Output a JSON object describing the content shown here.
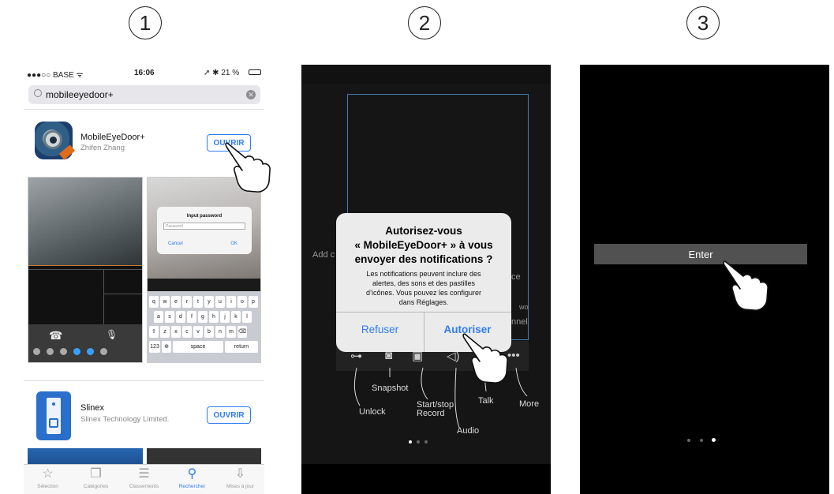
{
  "steps": [
    "1",
    "2",
    "3"
  ],
  "screen1": {
    "status": {
      "carrier": "●●●○○ BASE ᯤ",
      "time": "16:06",
      "right": "➚ ✱ 21 %"
    },
    "search": {
      "query": "mobileeyedoor+",
      "clear_icon": "clear-icon",
      "search_icon": "magnifier-icon"
    },
    "app1": {
      "name": "MobileEyeDoor+",
      "developer": "Zhifen Zhang",
      "button": "OUVRIR"
    },
    "screenshot_dialog": {
      "title": "Input password",
      "placeholder": "Password",
      "cancel": "Cancel",
      "ok": "OK"
    },
    "keyboard": {
      "row1": [
        "q",
        "w",
        "e",
        "r",
        "t",
        "y",
        "u",
        "i",
        "o",
        "p"
      ],
      "row2": [
        "a",
        "s",
        "d",
        "f",
        "g",
        "h",
        "j",
        "k",
        "l"
      ],
      "row3": [
        "⇧",
        "z",
        "x",
        "c",
        "v",
        "b",
        "n",
        "m",
        "⌫"
      ],
      "space": "space",
      "return": "return",
      "num": "123"
    },
    "app2": {
      "name": "Slinex",
      "developer": "Slinex Technology Limited.",
      "button": "OUVRIR"
    },
    "tabs": [
      {
        "label": "Sélection",
        "icon": "star-icon"
      },
      {
        "label": "Catégories",
        "icon": "categories-icon"
      },
      {
        "label": "Classements",
        "icon": "list-icon"
      },
      {
        "label": "Rechercher",
        "icon": "search-icon",
        "active": true
      },
      {
        "label": "Mises à jour",
        "icon": "download-icon"
      }
    ]
  },
  "screen2": {
    "alert": {
      "title": "Autorisez-vous\n« MobileEyeDoor+ » à vous\nenvoyer des notifications ?",
      "message": "Les notifications peuvent inclure des\nalertes, des sons et des pastilles\nd’icônes. Vous pouvez les configurer\ndans Réglages.",
      "deny": "Refuser",
      "allow": "Autoriser"
    },
    "ghost_labels": {
      "left": "Add c",
      "right1": "ce",
      "right2": "wo",
      "right3": "nnel"
    },
    "callouts": {
      "unlock": "Unlock",
      "snapshot": "Snapshot",
      "record": "Start/stop\nRecord",
      "audio": "Audio",
      "talk": "Talk",
      "more": "More"
    },
    "page_indicator": {
      "count": 3,
      "active": 0
    }
  },
  "screen3": {
    "enter": "Enter",
    "page_indicator": {
      "count": 3,
      "active": 2
    }
  },
  "colors": {
    "ios_blue": "#2f7cf6",
    "frame_blue": "#3f7fb8",
    "enter_bar": "#515151"
  }
}
